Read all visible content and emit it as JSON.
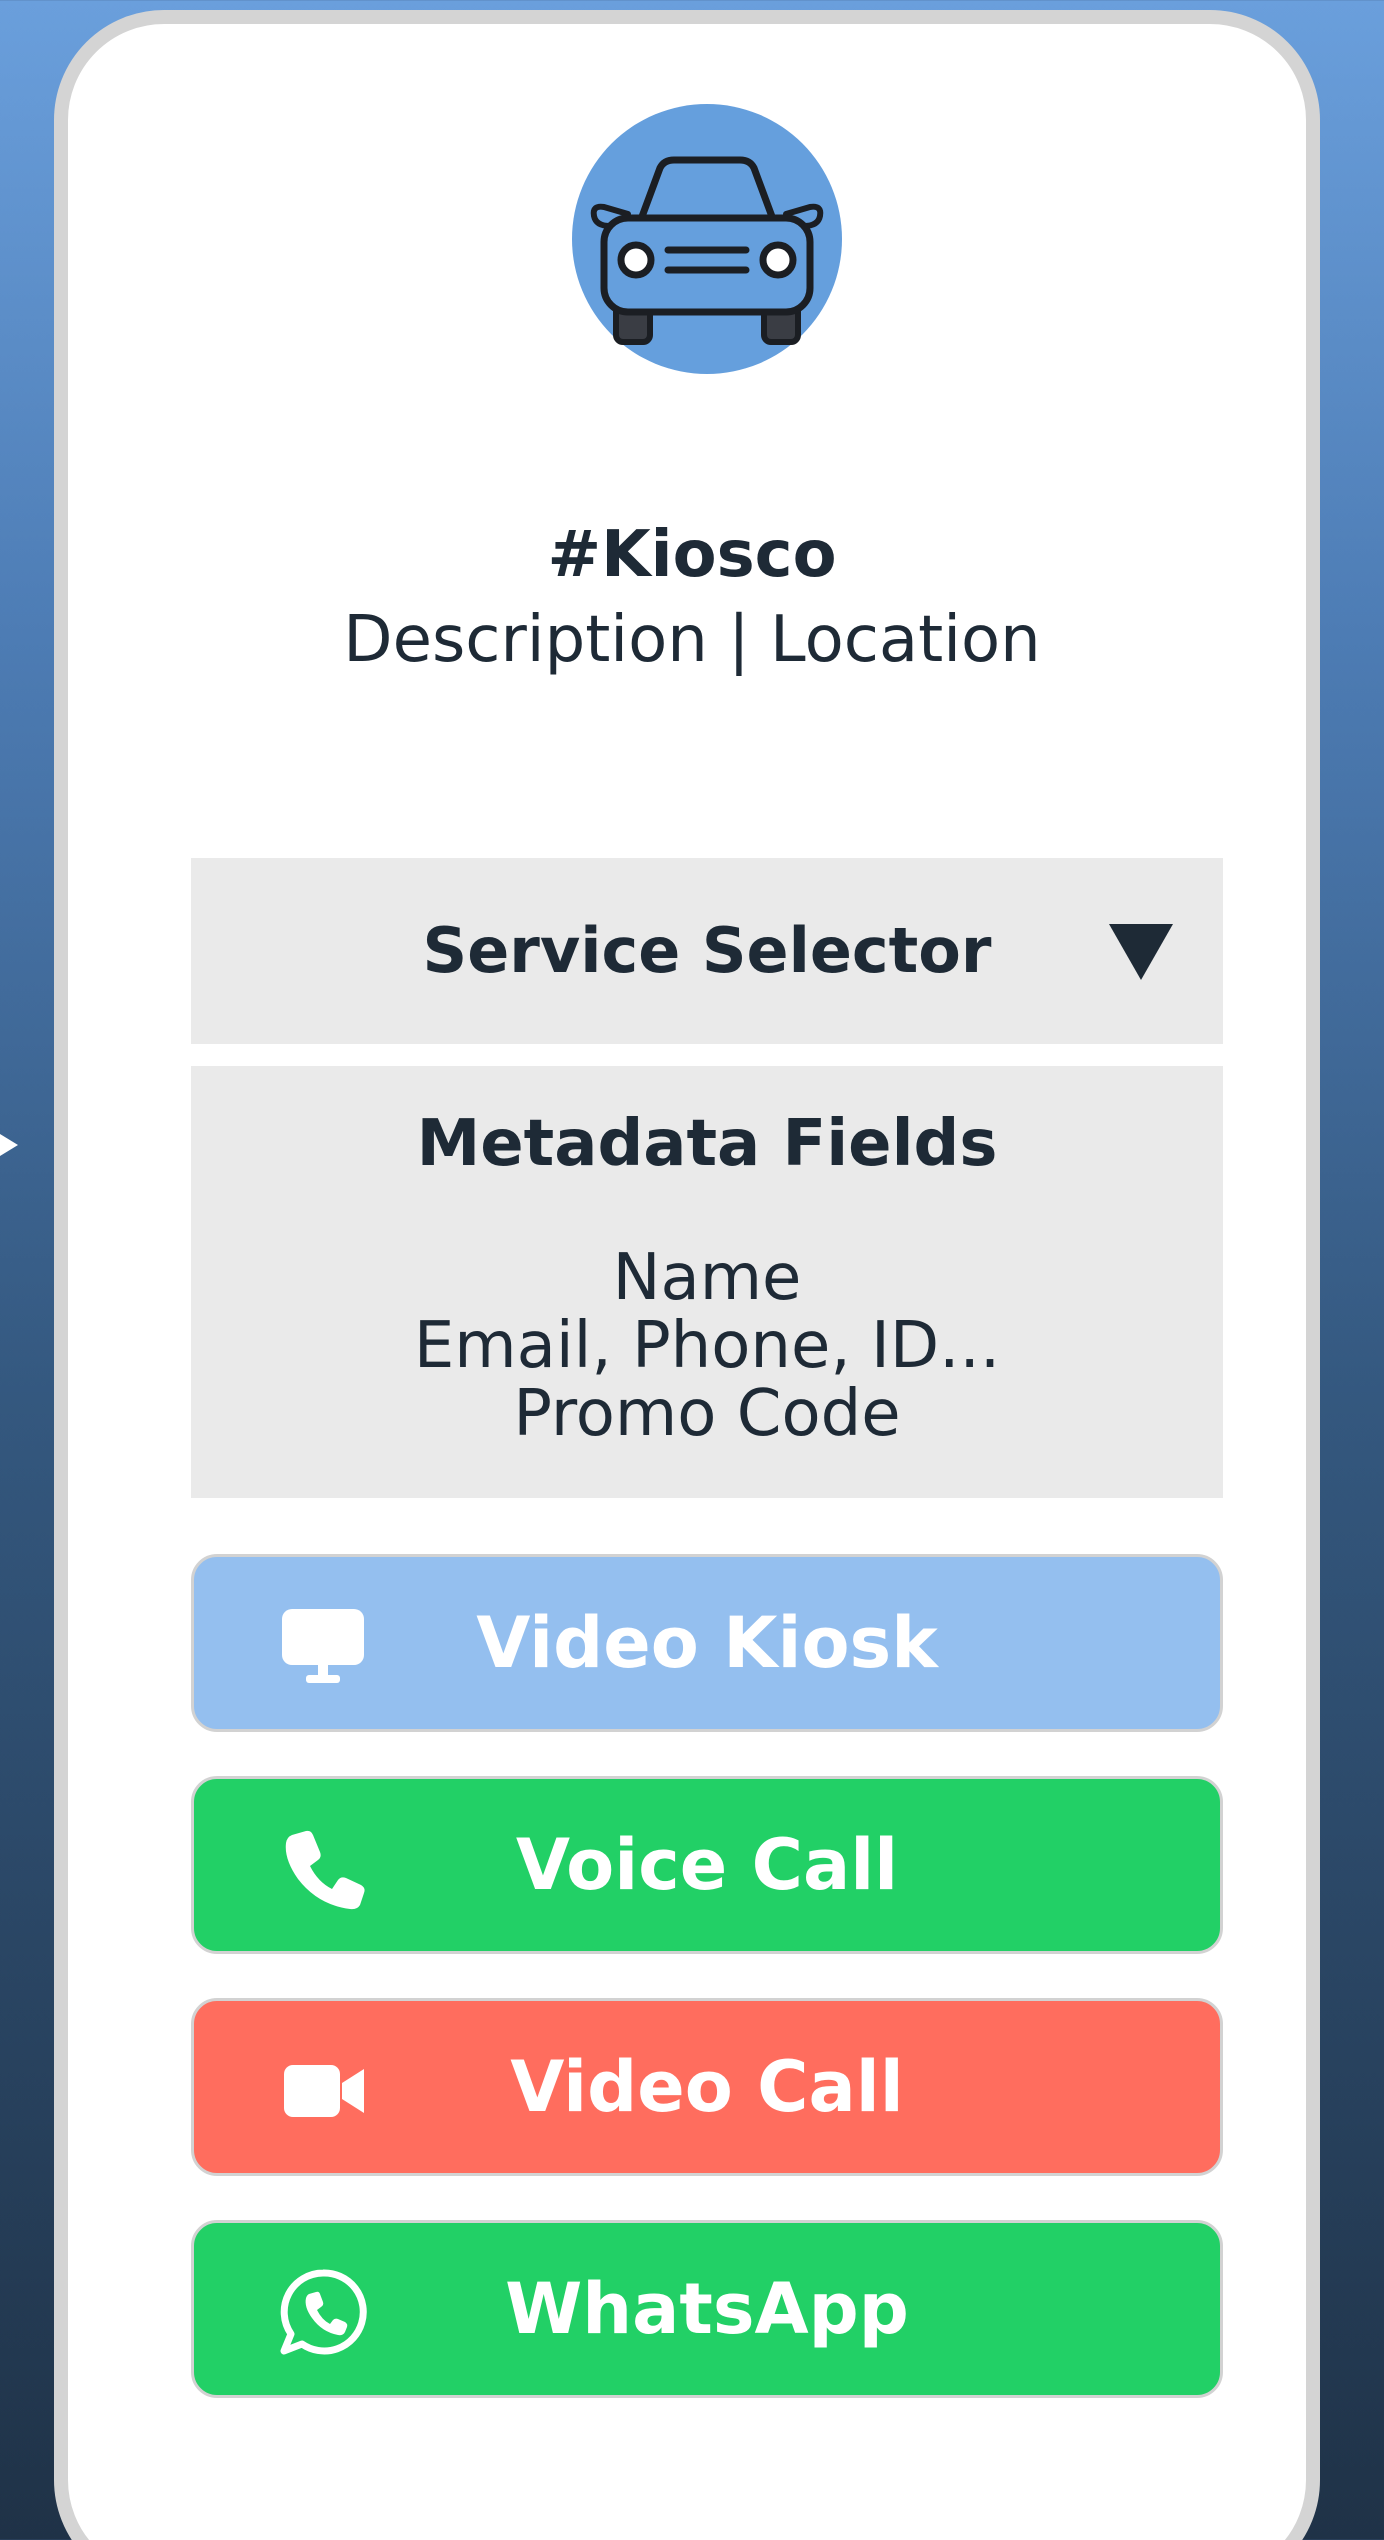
{
  "header": {
    "icon": "car-icon",
    "title": "#Kiosco",
    "subtitle": "Description | Location"
  },
  "service_selector": {
    "label": "Service Selector",
    "icon": "caret-down-icon"
  },
  "metadata": {
    "title": "Metadata Fields",
    "fields": [
      "Name",
      "Email, Phone, ID...",
      "Promo Code"
    ]
  },
  "actions": [
    {
      "label": "Video Kiosk",
      "icon": "monitor-icon",
      "color": "#94bfef"
    },
    {
      "label": "Voice Call",
      "icon": "phone-icon",
      "color": "#22d066"
    },
    {
      "label": "Video Call",
      "icon": "video-camera-icon",
      "color": "#ff6d5e"
    },
    {
      "label": "WhatsApp",
      "icon": "whatsapp-icon",
      "color": "#22d066"
    }
  ],
  "colors": {
    "avatar_bg": "#659fdd",
    "panel_bg": "#eaeaea",
    "text": "#1e2a36"
  }
}
